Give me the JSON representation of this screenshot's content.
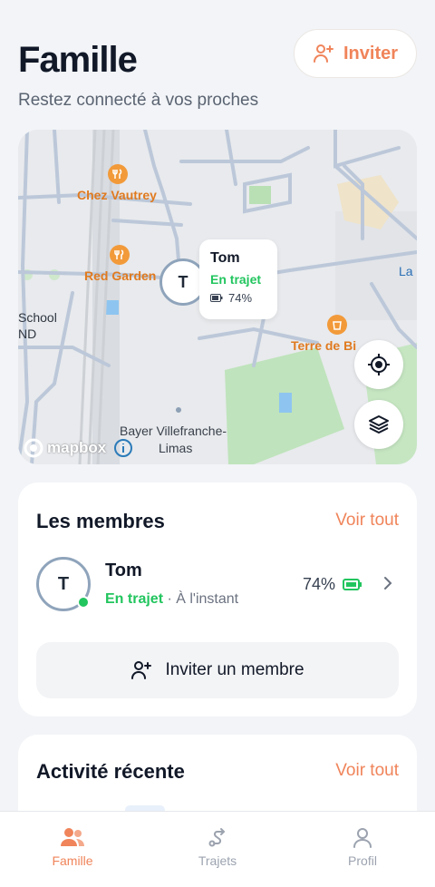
{
  "header": {
    "title": "Famille",
    "subtitle": "Restez connecté à vos proches",
    "invite_label": "Inviter"
  },
  "map": {
    "pois": [
      {
        "name": "Chez Vautrey"
      },
      {
        "name": "Red Garden"
      },
      {
        "name": "Terre de Bi"
      }
    ],
    "labels": {
      "school_1": "School",
      "school_2": "ND",
      "la": "La",
      "bayer_1": "Bayer Villefranche-",
      "bayer_2": "Limas"
    },
    "attribution": "mapbox",
    "member_popup": {
      "initial": "T",
      "name": "Tom",
      "status": "En trajet",
      "battery": "74%"
    }
  },
  "members": {
    "title": "Les membres",
    "see_all": "Voir tout",
    "list": [
      {
        "initial": "T",
        "name": "Tom",
        "status": "En trajet",
        "time": "· À l'instant",
        "battery": "74%"
      }
    ],
    "invite_member_label": "Inviter un membre"
  },
  "activity": {
    "title": "Activité récente",
    "see_all": "Voir tout"
  },
  "tabbar": {
    "tabs": [
      {
        "label": "Famille",
        "active": true
      },
      {
        "label": "Trajets",
        "active": false
      },
      {
        "label": "Profil",
        "active": false
      }
    ]
  },
  "colors": {
    "accent": "#f0845a",
    "online": "#22c55e",
    "background": "#f2f4f7"
  }
}
